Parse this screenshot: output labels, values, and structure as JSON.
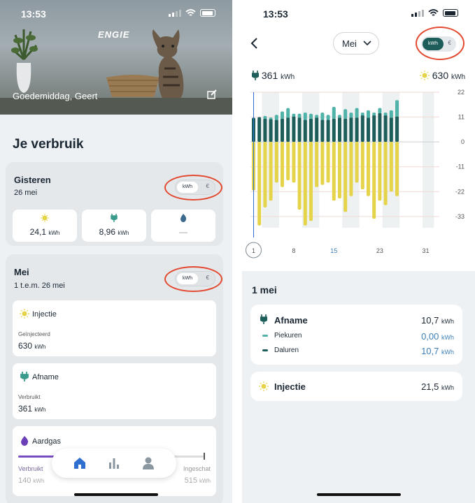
{
  "left": {
    "status": {
      "time": "13:53"
    },
    "header": {
      "logo": "ENGIE",
      "greeting": "Goedemiddag, Geert"
    },
    "section_title": "Je verbruik",
    "yesterday": {
      "title": "Gisteren",
      "subtitle": "26 mei",
      "toggle": {
        "on": "kWh",
        "off": "€"
      },
      "tiles": [
        {
          "icon": "sun-icon",
          "value": "24,1",
          "unit": "kWh"
        },
        {
          "icon": "plug-icon",
          "value": "8,96",
          "unit": "kWh"
        },
        {
          "icon": "flame-icon",
          "value": "—",
          "unit": ""
        }
      ]
    },
    "month": {
      "title": "Mei",
      "subtitle": "1 t.e.m. 26 mei",
      "toggle": {
        "on": "kWh",
        "off": "€"
      },
      "injectie": {
        "title": "Injectie",
        "label": "Geïnjecteerd",
        "value": "630",
        "unit": "kWh"
      },
      "afname": {
        "title": "Afname",
        "label": "Verbruikt",
        "value": "361",
        "unit": "kWh"
      },
      "aardgas": {
        "title": "Aardgas",
        "label_left": "Verbruikt",
        "value_left": "140",
        "unit_left": "kWh",
        "label_right": "Ingeschat",
        "value_right": "515",
        "unit_right": "kWh",
        "progress": 0.27
      }
    },
    "nav": [
      "home-icon",
      "chart-icon",
      "profile-icon"
    ]
  },
  "right": {
    "status": {
      "time": "13:53"
    },
    "month_select": "Mei",
    "toggle": {
      "on": "kWh",
      "off": "€"
    },
    "total_left": {
      "value": "361",
      "unit": "kWh"
    },
    "total_right": {
      "value": "630",
      "unit": "kWh"
    },
    "day_title": "1 mei",
    "afname": {
      "title": "Afname",
      "value": "10,7",
      "unit": "kWh",
      "rows": [
        {
          "label": "Piekuren",
          "value": "0,00",
          "unit": "kWh"
        },
        {
          "label": "Daluren",
          "value": "10,7",
          "unit": "kWh"
        }
      ]
    },
    "injectie": {
      "title": "Injectie",
      "value": "21,5",
      "unit": "kWh"
    }
  },
  "colors": {
    "dark_teal": "#1e5e5a",
    "light_teal": "#4fb3aa",
    "yellow": "#e5d34a",
    "red_circle": "#e3492f"
  },
  "chart_data": {
    "type": "bar",
    "x_ticks": [
      "1",
      "8",
      "15",
      "23",
      "31"
    ],
    "y_ticks": [
      "22",
      "11",
      "0",
      "-11",
      "-22",
      "-33"
    ],
    "ylim": [
      -38,
      22
    ],
    "selected_day": "1",
    "weekend_days": [
      3,
      4,
      10,
      11,
      17,
      18,
      24,
      25,
      31
    ],
    "days": [
      1,
      2,
      3,
      4,
      5,
      6,
      7,
      8,
      9,
      10,
      11,
      12,
      13,
      14,
      15,
      16,
      17,
      18,
      19,
      20,
      21,
      22,
      23,
      24,
      25,
      26,
      27,
      28,
      29,
      30,
      31
    ],
    "series": [
      {
        "name": "Daluren",
        "values": [
          10.7,
          11,
          10.5,
          10.3,
          10,
          10.5,
          11,
          11.5,
          11,
          10,
          10.5,
          11,
          10,
          10,
          10.5,
          11,
          10.5,
          11,
          11,
          12,
          11,
          12,
          13,
          12,
          11,
          11.5,
          null,
          null,
          null,
          null,
          null
        ]
      },
      {
        "name": "Piekuren",
        "values": [
          0,
          0,
          1,
          0.5,
          2,
          3,
          4,
          1,
          1.5,
          3,
          2,
          1,
          3,
          2,
          5,
          1,
          4,
          2,
          4,
          1,
          3,
          1,
          2,
          1,
          3,
          7,
          null,
          null,
          null,
          null,
          null
        ]
      },
      {
        "name": "Injectie",
        "values": [
          -21.5,
          -37,
          -29,
          -26,
          -18,
          -20,
          -17,
          -18,
          -30,
          -37,
          -35,
          -20,
          -19,
          -18,
          -26,
          -25,
          -31,
          -24,
          -18,
          -21,
          -24,
          -34,
          -26,
          -28,
          -22,
          -24,
          null,
          null,
          null,
          null,
          null
        ]
      }
    ]
  }
}
